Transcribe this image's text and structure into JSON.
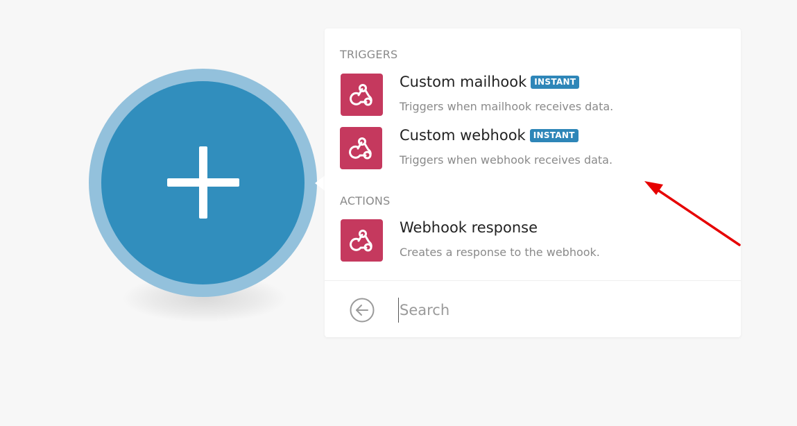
{
  "add_button": {
    "icon": "plus-icon"
  },
  "panel": {
    "triggers_heading": "TRIGGERS",
    "actions_heading": "ACTIONS",
    "triggers": [
      {
        "title": "Custom mailhook",
        "badge": "INSTANT",
        "description": "Triggers when mailhook receives data.",
        "icon": "webhook-icon"
      },
      {
        "title": "Custom webhook",
        "badge": "INSTANT",
        "description": "Triggers when webhook receives data.",
        "icon": "webhook-icon"
      }
    ],
    "actions": [
      {
        "title": "Webhook response",
        "description": "Creates a response to the webhook.",
        "icon": "webhook-icon"
      }
    ],
    "search": {
      "placeholder": "Search",
      "value": ""
    },
    "back_icon": "arrow-left-circle-icon"
  },
  "colors": {
    "module_bg": "#318ebd",
    "module_ring": "#93c1dc",
    "app_icon_bg": "#c5395e",
    "badge_bg": "#2e86b8",
    "annotation_arrow": "#e60000"
  }
}
